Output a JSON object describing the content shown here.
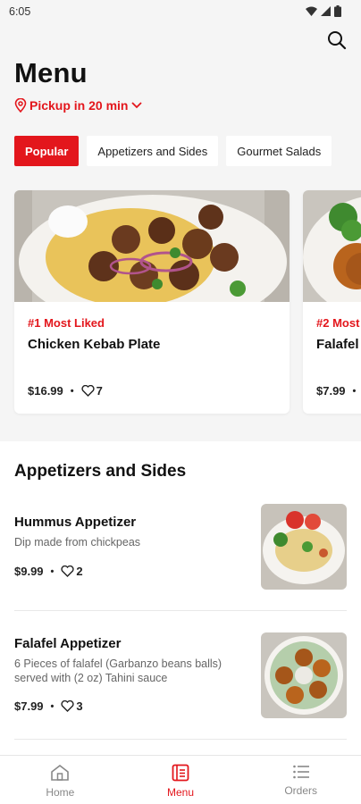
{
  "status_bar": {
    "time": "6:05"
  },
  "header": {
    "title": "Menu",
    "pickup": "Pickup in 20 min"
  },
  "tabs": [
    {
      "label": "Popular",
      "active": true
    },
    {
      "label": "Appetizers and Sides",
      "active": false
    },
    {
      "label": "Gourmet Salads",
      "active": false
    }
  ],
  "featured": [
    {
      "rank": "#1 Most Liked",
      "name": "Chicken Kebab Plate",
      "price": "$16.99",
      "likes": "7"
    },
    {
      "rank": "#2 Most",
      "name": "Falafel",
      "price": "$7.99",
      "likes": ""
    }
  ],
  "section": {
    "title": "Appetizers and Sides",
    "items": [
      {
        "name": "Hummus Appetizer",
        "description": "Dip made from chickpeas",
        "price": "$9.99",
        "likes": "2"
      },
      {
        "name": "Falafel Appetizer",
        "description": "6 Pieces of falafel (Garbanzo beans balls) served with (2 oz) Tahini sauce",
        "price": "$7.99",
        "likes": "3"
      }
    ]
  },
  "bottom_nav": [
    {
      "label": "Home",
      "icon": "home-icon",
      "active": false
    },
    {
      "label": "Menu",
      "icon": "menu-book-icon",
      "active": true
    },
    {
      "label": "Orders",
      "icon": "list-icon",
      "active": false
    }
  ],
  "colors": {
    "accent": "#e3161c",
    "background": "#f5f5f5"
  }
}
